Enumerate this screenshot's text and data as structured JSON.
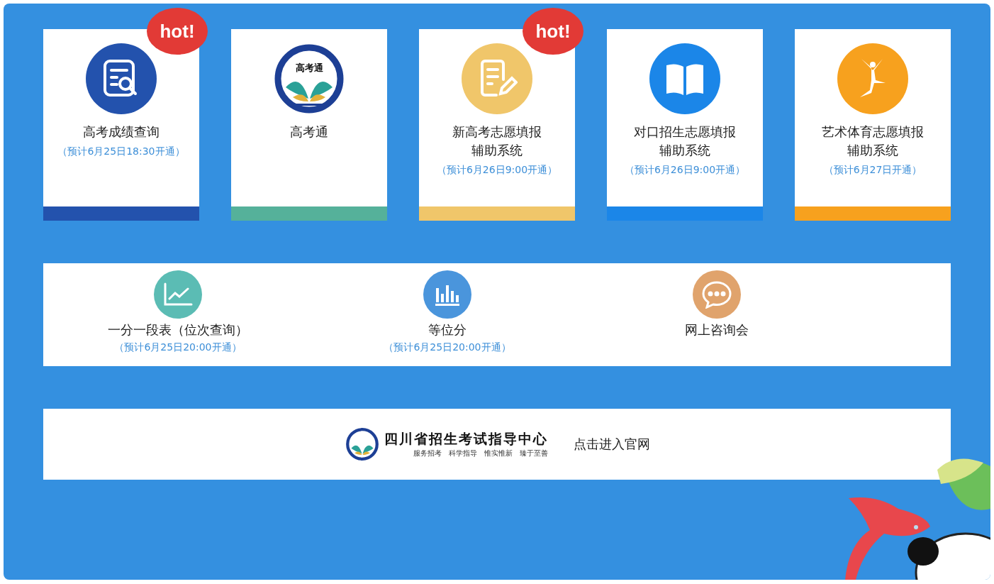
{
  "services": [
    {
      "kind": "search",
      "lines": [
        "高考成绩查询"
      ],
      "note": "（预计6月25日18:30开通）",
      "color": "#2352ad",
      "hot": true,
      "badge": "hot!"
    },
    {
      "kind": "emblem",
      "lines": [
        "高考通"
      ],
      "emblem_text": "高考通",
      "color": "#55b19a",
      "hot": false
    },
    {
      "kind": "edit",
      "lines": [
        "新高考志愿填报",
        "辅助系统"
      ],
      "note": "（预计6月26日9:00开通）",
      "color": "#f0c66a",
      "hot": true,
      "badge": "hot!"
    },
    {
      "kind": "book",
      "lines": [
        "对口招生志愿填报",
        "辅助系统"
      ],
      "note": "（预计6月26日9:00开通）",
      "color": "#1b86e8",
      "hot": false
    },
    {
      "kind": "dancer",
      "lines": [
        "艺术体育志愿填报",
        "辅助系统"
      ],
      "note": "（预计6月27日开通）",
      "color": "#f7a11e",
      "hot": false
    }
  ],
  "tools": [
    {
      "kind": "line-chart",
      "label": "一分一段表（位次查询）",
      "note": "（预计6月25日20:00开通）",
      "color": "#5bbcb4"
    },
    {
      "kind": "bar-chart",
      "label": "等位分",
      "note": "（预计6月25日20:00开通）",
      "color": "#4a95dc"
    },
    {
      "kind": "chat",
      "label": "网上咨询会",
      "color": "#e0a36c"
    }
  ],
  "official": {
    "org_name": "四川省招生考试指导中心",
    "motto": "服务招考　科学指导　惟实惟新　臻于至善",
    "link": "点击进入官网"
  }
}
